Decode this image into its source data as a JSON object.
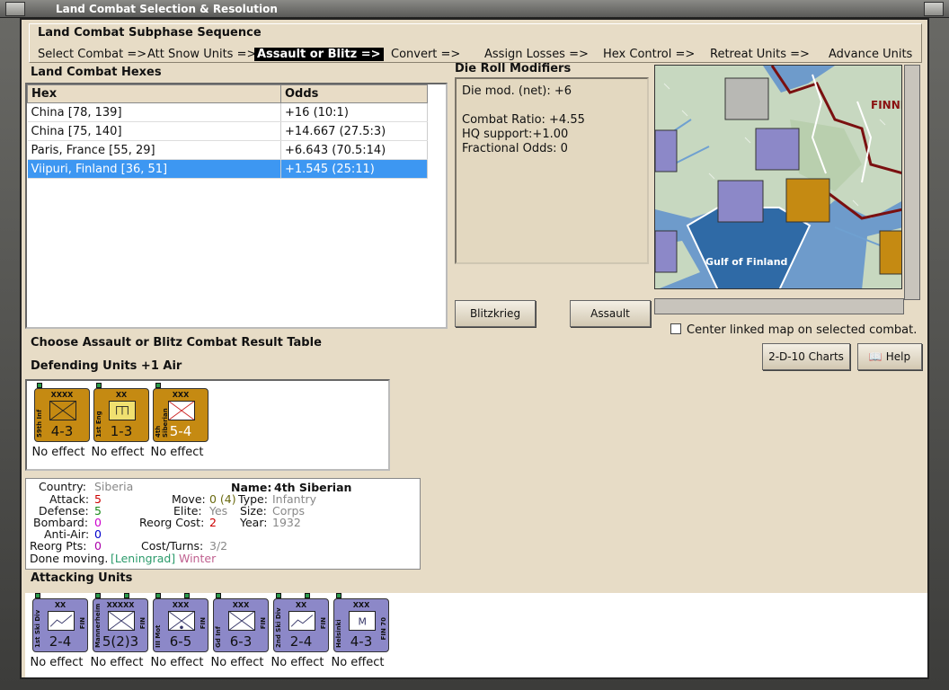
{
  "window": {
    "title": "Land Combat Selection & Resolution"
  },
  "subphase": {
    "heading": "Land Combat Subphase Sequence",
    "steps": [
      "Select Combat =>",
      "Att Snow Units =>",
      "Assault or Blitz =>",
      "Convert =>",
      "Assign Losses =>",
      "Hex Control =>",
      "Retreat Units =>",
      "Advance Units"
    ],
    "active_step": "Assault or Blitz =>"
  },
  "hexes": {
    "label": "Land Combat Hexes",
    "columns": [
      "Hex",
      "Odds"
    ],
    "rows": [
      {
        "hex": "China [78, 139]",
        "odds": "+16 (10:1)"
      },
      {
        "hex": "China [75, 140]",
        "odds": "+14.667 (27.5:3)"
      },
      {
        "hex": "Paris, France [55, 29]",
        "odds": "+6.643 (70.5:14)"
      },
      {
        "hex": "Viipuri, Finland [36, 51]",
        "odds": "+1.545 (25:11)"
      }
    ],
    "selected": "Viipuri, Finland [36, 51]"
  },
  "drm": {
    "label": "Die Roll Modifiers",
    "text": "Die mod. (net): +6\n\nCombat Ratio: +4.55\nHQ support:+1.00\nFractional Odds: 0"
  },
  "buttons": {
    "blitzkrieg": "Blitzkrieg",
    "assault": "Assault",
    "charts": "2-D-10 Charts",
    "help": "Help"
  },
  "center_map": {
    "label": "Center linked map on selected combat.",
    "checked": false
  },
  "labels": {
    "choose_crt": "Choose Assault or Blitz Combat Result Table",
    "defending": "Defending Units +1 Air",
    "attacking": "Attacking Units"
  },
  "defending": [
    {
      "size": "XXXX",
      "name": "59th Inf",
      "strength": "4-3",
      "result": "No effect"
    },
    {
      "size": "XX",
      "name": "1st Eng",
      "strength": "1-3",
      "result": "No effect"
    },
    {
      "size": "XXX",
      "name": "4th Siberian",
      "strength": "5-4",
      "result": "No effect"
    }
  ],
  "info": {
    "country_label": "Country:",
    "country": "Siberia",
    "name_label": "Name:",
    "name": "4th Siberian",
    "attack_label": "Attack:",
    "attack": "5",
    "move_label": "Move:",
    "move": "0 (4)",
    "type_label": "Type:",
    "type": "Infantry",
    "defense_label": "Defense:",
    "defense": "5",
    "elite_label": "Elite:",
    "elite": "Yes",
    "size_label": "Size:",
    "size": "Corps",
    "bombard_label": "Bombard:",
    "bombard": "0",
    "reorg_cost_label": "Reorg Cost:",
    "reorg_cost": "2",
    "year_label": "Year:",
    "year": "1932",
    "anti_air_label": "Anti-Air:",
    "anti_air": "0",
    "reorg_pts_label": "Reorg Pts:",
    "reorg_pts": "0",
    "cost_turns_label": "Cost/Turns:",
    "cost_turns": "3/2",
    "done_moving": "Done moving.",
    "location": "[Leningrad]",
    "weather": "Winter"
  },
  "attacking": [
    {
      "size": "XX",
      "name": "1st Ski Div",
      "nation": "FIN",
      "strength": "2-4",
      "result": "No effect"
    },
    {
      "size": "XXXXX",
      "name": "Mannerheim",
      "nation": "FIN",
      "strength": "5(2)3",
      "result": "No effect"
    },
    {
      "size": "XXX",
      "name": "III Mot",
      "nation": "FIN",
      "strength": "6-5",
      "result": "No effect"
    },
    {
      "size": "XXX",
      "name": "Gd Inf",
      "nation": "FIN",
      "strength": "6-3",
      "result": "No effect"
    },
    {
      "size": "XX",
      "name": "2nd Ski Div",
      "nation": "FIN",
      "strength": "2-4",
      "result": "No effect"
    },
    {
      "size": "XXX",
      "name": "Helsinki",
      "nation": "FIN 70",
      "strength": "4-3",
      "result": "No effect"
    }
  ],
  "colors": {
    "parchment": "#e7dcc6",
    "selection": "#3d97f2",
    "axis_unit": "#8c88c8",
    "soviet_unit": "#c58a12"
  }
}
